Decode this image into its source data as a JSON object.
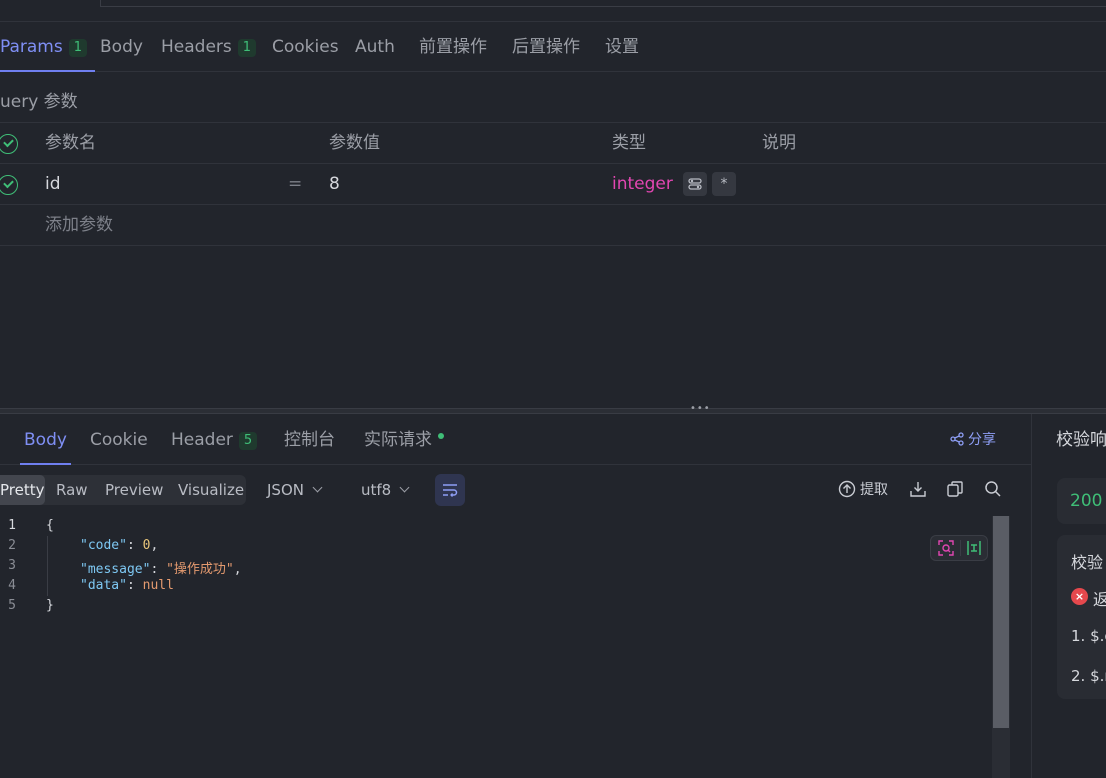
{
  "request_tabs": {
    "params": {
      "label": "Params",
      "badge": "1"
    },
    "body": {
      "label": "Body"
    },
    "headers": {
      "label": "Headers",
      "badge": "1"
    },
    "cookies": {
      "label": "Cookies"
    },
    "auth": {
      "label": "Auth"
    },
    "pre": {
      "label": "前置操作"
    },
    "post": {
      "label": "后置操作"
    },
    "settings": {
      "label": "设置"
    }
  },
  "query": {
    "title": "uery 参数",
    "columns": {
      "name": "参数名",
      "value": "参数值",
      "type": "类型",
      "desc": "说明"
    },
    "rows": [
      {
        "name": "id",
        "eq": "=",
        "value": "8",
        "type": "integer",
        "required_mark": "*"
      }
    ],
    "add_placeholder": "添加参数"
  },
  "response_tabs": {
    "body": {
      "label": "Body"
    },
    "cookie": {
      "label": "Cookie"
    },
    "header": {
      "label": "Header",
      "badge": "5"
    },
    "console": {
      "label": "控制台"
    },
    "actual": {
      "label": "实际请求"
    },
    "share": {
      "label": "分享"
    }
  },
  "view_modes": {
    "pretty": "Pretty",
    "raw": "Raw",
    "preview": "Preview",
    "visualize": "Visualize"
  },
  "format_select": "JSON",
  "encoding_select": "utf8",
  "toolbar": {
    "extract_label": "提取"
  },
  "editor": {
    "line_numbers": [
      "1",
      "2",
      "3",
      "4",
      "5"
    ],
    "open_brace": "{",
    "close_brace": "}",
    "code_key": "\"code\"",
    "code_value": "0",
    "message_key": "\"message\"",
    "message_value": "\"操作成功\"",
    "data_key": "\"data\"",
    "data_value": "null"
  },
  "validation": {
    "title": "校验响",
    "status_code": "200",
    "card_title": "校验",
    "error_line": "返",
    "item1": "1. $.c",
    "item2": "2. $.r"
  },
  "colors": {
    "accent": "#7f8ff4",
    "success": "#3fbe77",
    "type_pink": "#e246b2",
    "error": "#e5484d"
  }
}
